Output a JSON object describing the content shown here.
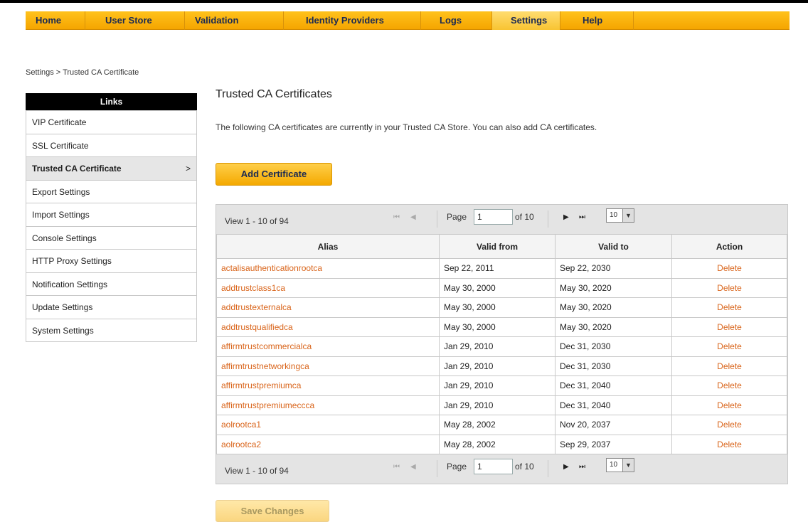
{
  "nav": {
    "items": [
      {
        "label": "Home"
      },
      {
        "label": "User Store"
      },
      {
        "label": "Validation"
      },
      {
        "label": "Identity Providers"
      },
      {
        "label": "Logs"
      },
      {
        "label": "Settings",
        "active": true
      },
      {
        "label": "Help"
      }
    ]
  },
  "breadcrumb": "Settings > Trusted CA Certificate",
  "sidebar": {
    "header": "Links",
    "items": [
      {
        "label": "VIP Certificate"
      },
      {
        "label": "SSL Certificate"
      },
      {
        "label": "Trusted CA Certificate",
        "active": true
      },
      {
        "label": "Export Settings"
      },
      {
        "label": "Import Settings"
      },
      {
        "label": "Console Settings"
      },
      {
        "label": "HTTP Proxy Settings"
      },
      {
        "label": "Notification Settings"
      },
      {
        "label": "Update Settings"
      },
      {
        "label": "System Settings"
      }
    ],
    "active_arrow": ">"
  },
  "main": {
    "title": "Trusted CA Certificates",
    "description": "The following CA certificates are currently in your Trusted CA Store. You can also add CA certificates.",
    "add_button": "Add Certificate",
    "save_button": "Save Changes"
  },
  "pager": {
    "view_text": "View 1 - 10 of 94",
    "page_label": "Page",
    "page_value": "1",
    "of_label": "of 10",
    "page_size": "10",
    "first_icon": "⏮",
    "prev_icon": "◀",
    "next_icon": "▶",
    "last_icon": "⏭",
    "dropdown_icon": "▼"
  },
  "table": {
    "columns": [
      "Alias",
      "Valid from",
      "Valid to",
      "Action"
    ],
    "rows": [
      {
        "alias": "actalisauthenticationrootca",
        "from": "Sep 22, 2011",
        "to": "Sep 22, 2030",
        "action": "Delete"
      },
      {
        "alias": "addtrustclass1ca",
        "from": "May 30, 2000",
        "to": "May 30, 2020",
        "action": "Delete"
      },
      {
        "alias": "addtrustexternalca",
        "from": "May 30, 2000",
        "to": "May 30, 2020",
        "action": "Delete"
      },
      {
        "alias": "addtrustqualifiedca",
        "from": "May 30, 2000",
        "to": "May 30, 2020",
        "action": "Delete"
      },
      {
        "alias": "affirmtrustcommercialca",
        "from": "Jan 29, 2010",
        "to": "Dec 31, 2030",
        "action": "Delete"
      },
      {
        "alias": "affirmtrustnetworkingca",
        "from": "Jan 29, 2010",
        "to": "Dec 31, 2030",
        "action": "Delete"
      },
      {
        "alias": "affirmtrustpremiumca",
        "from": "Jan 29, 2010",
        "to": "Dec 31, 2040",
        "action": "Delete"
      },
      {
        "alias": "affirmtrustpremiumeccca",
        "from": "Jan 29, 2010",
        "to": "Dec 31, 2040",
        "action": "Delete"
      },
      {
        "alias": "aolrootca1",
        "from": "May 28, 2002",
        "to": "Nov 20, 2037",
        "action": "Delete"
      },
      {
        "alias": "aolrootca2",
        "from": "May 28, 2002",
        "to": "Sep 29, 2037",
        "action": "Delete"
      }
    ]
  },
  "colors": {
    "nav_bg": "#f5a500",
    "link": "#d9641a",
    "sidebar_header": "#000000"
  }
}
